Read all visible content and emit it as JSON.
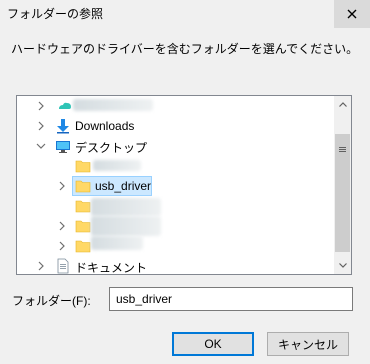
{
  "window": {
    "title": "フォルダーの参照",
    "close_glyph": "✕"
  },
  "instruction": "ハードウェアのドライバーを含むフォルダーを選んでください。",
  "tree": {
    "items": [
      {
        "label": "",
        "icon": "cloud-icon",
        "expander": "chevron-right-icon",
        "blurred": true
      },
      {
        "label": "Downloads",
        "icon": "download-arrow-icon",
        "expander": "chevron-right-icon"
      },
      {
        "label": "デスクトップ",
        "icon": "desktop-icon",
        "expander": "chevron-down-icon"
      },
      {
        "label": "",
        "icon": "folder-icon",
        "expander": "none",
        "blurred": true
      },
      {
        "label": "usb_driver",
        "icon": "folder-icon",
        "expander": "chevron-right-icon",
        "selected": true
      },
      {
        "label": "",
        "icon": "folder-icon",
        "expander": "none",
        "blurred": true
      },
      {
        "label": "",
        "icon": "folder-icon",
        "expander": "chevron-right-icon",
        "blurred": true
      },
      {
        "label": "",
        "icon": "folder-icon",
        "expander": "chevron-right-icon",
        "blurred": true
      },
      {
        "label": "ドキュメント",
        "icon": "document-icon",
        "expander": "chevron-right-icon"
      }
    ]
  },
  "folder_field": {
    "label": "フォルダー(F):",
    "value": "usb_driver"
  },
  "buttons": {
    "ok": "OK",
    "cancel": "キャンセル"
  },
  "colors": {
    "selection_fill": "#cce8ff",
    "selection_border": "#99d1ff",
    "folder_yellow": "#ffd866",
    "download_blue": "#1e88e5",
    "desktop_blue": "#1976d2"
  }
}
